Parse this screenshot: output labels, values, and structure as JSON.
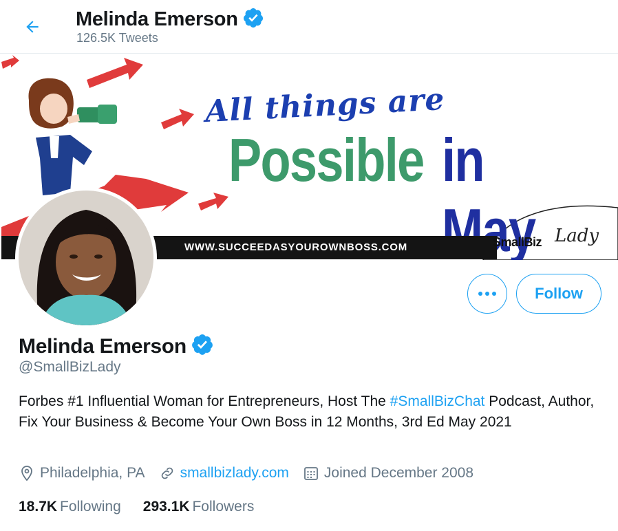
{
  "header": {
    "name": "Melinda Emerson",
    "tweet_count": "126.5K Tweets"
  },
  "banner": {
    "tagline_top": "All things are",
    "tagline_word1": "Possible",
    "tagline_word2": "in May",
    "url": "WWW.SUCCEEDASYOUROWNBOSS.COM",
    "logo_text": "SmallBiz",
    "logo_script": "Lady"
  },
  "actions": {
    "more_icon": "more-horizontal-icon",
    "follow_label": "Follow"
  },
  "profile": {
    "name": "Melinda Emerson",
    "handle": "@SmallBizLady",
    "bio_prefix": "Forbes #1 Influential Woman for Entrepreneurs, Host The ",
    "bio_hashtag": "#SmallBizChat",
    "bio_suffix": " Podcast, Author, Fix Your Business & Become Your Own Boss in 12 Months, 3rd Ed May 2021",
    "location": "Philadelphia, PA",
    "website": "smallbizlady.com",
    "joined": "Joined December 2008",
    "following_count": "18.7K",
    "following_label": "Following",
    "followers_count": "293.1K",
    "followers_label": "Followers"
  },
  "colors": {
    "accent": "#1da1f2",
    "secondary_text": "#657786",
    "primary_text": "#14171a"
  }
}
